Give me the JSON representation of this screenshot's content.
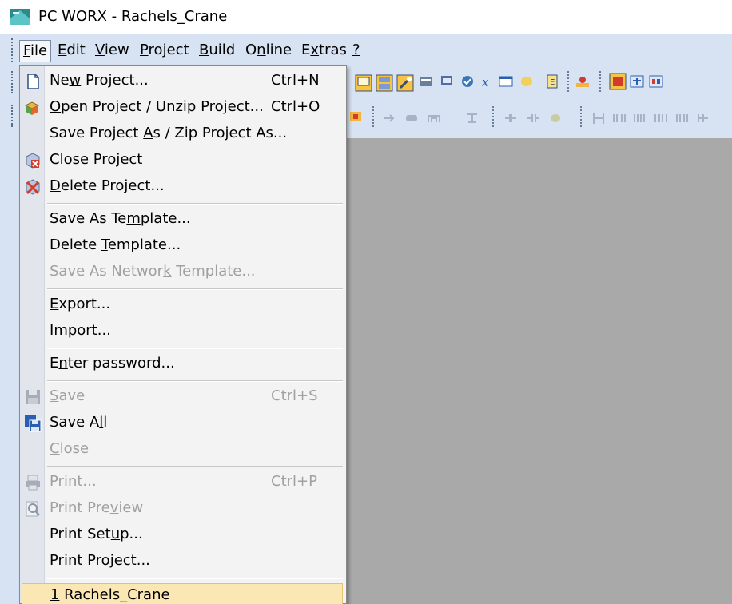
{
  "window": {
    "title": "PC WORX - Rachels_Crane"
  },
  "menubar": {
    "items": [
      {
        "id": "file",
        "pre": "",
        "key": "F",
        "post": "ile"
      },
      {
        "id": "edit",
        "pre": "",
        "key": "E",
        "post": "dit"
      },
      {
        "id": "view",
        "pre": "",
        "key": "V",
        "post": "iew"
      },
      {
        "id": "project",
        "pre": "",
        "key": "P",
        "post": "roject"
      },
      {
        "id": "build",
        "pre": "",
        "key": "B",
        "post": "uild"
      },
      {
        "id": "online",
        "pre": "O",
        "key": "n",
        "post": "line"
      },
      {
        "id": "extras",
        "pre": "E",
        "key": "x",
        "post": "tras"
      },
      {
        "id": "help",
        "pre": "",
        "key": "?",
        "post": ""
      }
    ]
  },
  "file_menu": {
    "new_project": {
      "pre": "Ne",
      "key": "w",
      "post": " Project...",
      "shortcut": "Ctrl+N"
    },
    "open_project": {
      "pre": "",
      "key": "O",
      "post": "pen Project / Unzip Project...",
      "shortcut": "Ctrl+O"
    },
    "save_project_as": {
      "pre": "Save Project ",
      "key": "A",
      "post": "s / Zip Project As...",
      "shortcut": ""
    },
    "close_project": {
      "pre": "Close P",
      "key": "r",
      "post": "oject",
      "shortcut": ""
    },
    "delete_project": {
      "pre": "",
      "key": "D",
      "post": "elete Project...",
      "shortcut": ""
    },
    "save_as_template": {
      "pre": "Save As Te",
      "key": "m",
      "post": "plate...",
      "shortcut": ""
    },
    "delete_template": {
      "pre": "Delete ",
      "key": "T",
      "post": "emplate...",
      "shortcut": ""
    },
    "save_as_network_template": {
      "pre": "Save As Networ",
      "key": "k",
      "post": " Template...",
      "shortcut": ""
    },
    "export": {
      "pre": "",
      "key": "E",
      "post": "xport...",
      "shortcut": ""
    },
    "import": {
      "pre": "",
      "key": "I",
      "post": "mport...",
      "shortcut": ""
    },
    "enter_password": {
      "pre": "E",
      "key": "n",
      "post": "ter password...",
      "shortcut": ""
    },
    "save": {
      "pre": "",
      "key": "S",
      "post": "ave",
      "shortcut": "Ctrl+S"
    },
    "save_all": {
      "pre": "Save A",
      "key": "l",
      "post": "l",
      "shortcut": ""
    },
    "close": {
      "pre": "",
      "key": "C",
      "post": "lose",
      "shortcut": ""
    },
    "print": {
      "pre": "",
      "key": "P",
      "post": "rint...",
      "shortcut": "Ctrl+P"
    },
    "print_preview": {
      "pre": "Print Pre",
      "key": "v",
      "post": "iew",
      "shortcut": ""
    },
    "print_setup": {
      "pre": "Print Set",
      "key": "u",
      "post": "p...",
      "shortcut": ""
    },
    "print_project": {
      "pre": "Print Pro",
      "key": "j",
      "post": "ect...",
      "shortcut": ""
    },
    "recent_1": {
      "pre": "",
      "key": "1",
      "post": " Rachels_Crane",
      "shortcut": ""
    }
  },
  "icons": {
    "app": "pc-worx-app-icon",
    "new_project": "new-document-icon",
    "open_project": "open-project-icon",
    "close_project": "close-project-icon",
    "delete_project": "delete-project-icon",
    "save": "save-disk-icon",
    "save_all": "save-all-icon",
    "print": "printer-icon",
    "print_preview": "print-preview-icon"
  },
  "colors": {
    "menubar_bg": "#d7e3f2",
    "workarea_bg": "#a9a9a9",
    "menu_bg": "#f3f3f3",
    "highlight_bg": "#fbe7b4",
    "disabled_text": "#a0a0a0"
  }
}
